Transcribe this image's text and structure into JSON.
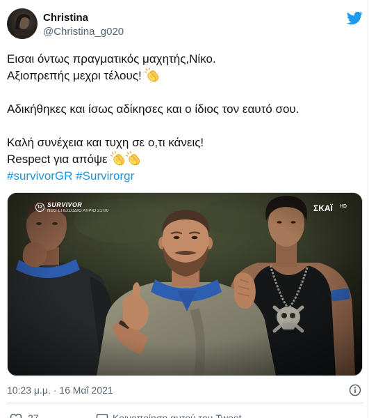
{
  "tweet": {
    "author": {
      "name": "Christina",
      "handle": "@Christina_g020",
      "avatar_icon": "profile-photo"
    },
    "brand_icon": "twitter-bird-icon",
    "paragraphs": [
      [
        {
          "text": "Εισαι όντως πραγματικός μαχητής,Νίκο."
        },
        {
          "text": "Αξιοπρεπής μεχρι τέλους!",
          "emoji": [
            "clapping-hands-icon"
          ]
        }
      ],
      [
        {
          "text": "Αδικήθηκες και ίσως αδίκησες και ο ίδιος τον εαυτό σου."
        }
      ],
      [
        {
          "text": "Καλή συνέχεια και τυχη σε ο,τι κάνεις!"
        },
        {
          "text": "Respect για απόψε",
          "emoji": [
            "clapping-hands-icon",
            "clapping-hands-icon"
          ]
        }
      ]
    ],
    "hashtags": [
      "#survivorGR",
      "#Survirorgr"
    ],
    "media": {
      "rating_badge": "12",
      "show_logo": "SURVIVOR",
      "show_promo": "ΝΕΟ ΕΠΕΙΣΟΔΙΟ ΑΥΡΙΟ 21:00",
      "channel_logo": "ΣΚΑΪ",
      "channel_badge": "HD"
    },
    "timestamp": "10:23 μ.μ. · 16 Μαΐ 2021",
    "info_icon": "info-icon",
    "actions": {
      "like_icon": "heart-icon",
      "like_count": "27",
      "share_icon": "speech-bubble-icon",
      "share_label": "Κοινοποίηση αυτού του Tweet"
    }
  },
  "colors": {
    "text": "#0f1419",
    "secondary": "#536471",
    "link": "#1b95e0",
    "brand": "#1d9bf0",
    "border": "#cfd9de"
  }
}
